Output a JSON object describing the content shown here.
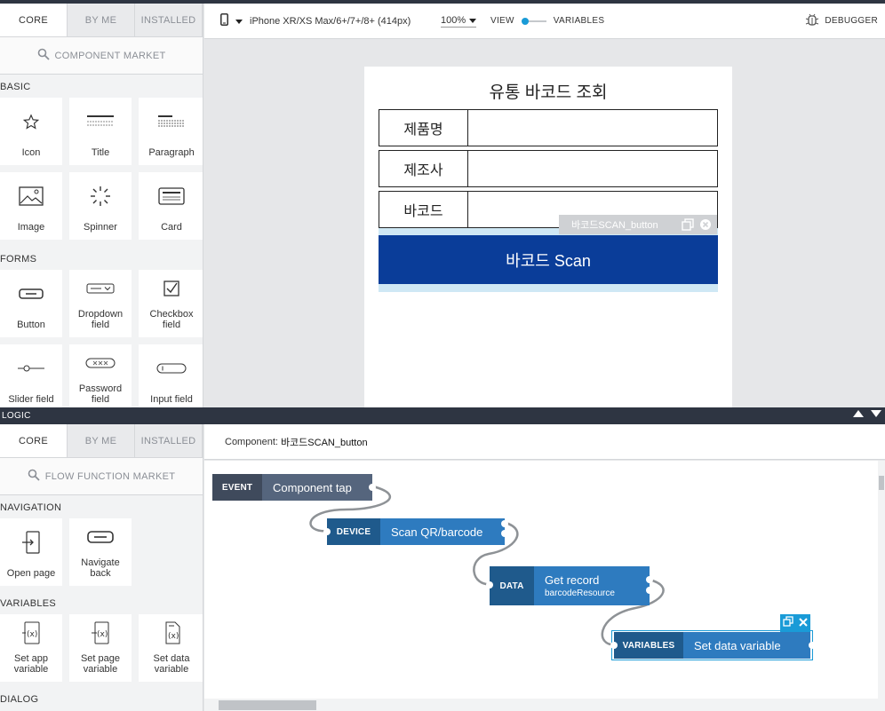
{
  "component_panel": {
    "tabs": [
      "CORE",
      "BY ME",
      "INSTALLED"
    ],
    "active_tab": "CORE",
    "market_label": "COMPONENT MARKET",
    "sections": {
      "basic": "BASIC",
      "forms": "FORMS"
    },
    "basic_items": [
      "Icon",
      "Title",
      "Paragraph",
      "Image",
      "Spinner",
      "Card"
    ],
    "form_items": [
      "Button",
      "Dropdown\nfield",
      "Checkbox\nfield",
      "Slider field",
      "Password\nfield",
      "Input field"
    ]
  },
  "toolbar": {
    "device": "iPhone XR/XS Max/6+/7+/8+ (414px)",
    "zoom": "100%",
    "view_label": "VIEW",
    "variables_label": "VARIABLES",
    "debugger_label": "DEBUGGER"
  },
  "phone": {
    "title": "유통 바코드 조회",
    "fields": [
      "제품명",
      "제조사",
      "바코드"
    ],
    "scan_button": "바코드 Scan",
    "selected_tag": "바코드SCAN_button"
  },
  "logic": {
    "bar_label": "LOGIC",
    "tabs": [
      "CORE",
      "BY ME",
      "INSTALLED"
    ],
    "market_label": "FLOW FUNCTION MARKET",
    "sections": {
      "navigation": "NAVIGATION",
      "variables": "VARIABLES",
      "dialog": "DIALOG"
    },
    "navigation_items": [
      "Open page",
      "Navigate\nback"
    ],
    "variable_items": [
      "Set app\nvariable",
      "Set page\nvariable",
      "Set data\nvariable"
    ],
    "component_prefix": "Component:",
    "component_name": "바코드SCAN_button",
    "nodes": [
      {
        "type": "EVENT",
        "name": "Component tap",
        "sub": ""
      },
      {
        "type": "DEVICE",
        "name": "Scan QR/barcode",
        "sub": ""
      },
      {
        "type": "DATA",
        "name": "Get record",
        "sub": "barcodeResource"
      },
      {
        "type": "VARIABLES",
        "name": "Set data variable",
        "sub": ""
      }
    ]
  },
  "colors": {
    "event_type": "#3f4a5c",
    "event_name": "#55657d",
    "device_type": "#1f5a8c",
    "device_name": "#2e7bbf",
    "scan_button": "#0a3d99",
    "accent": "#1a9bd7"
  }
}
